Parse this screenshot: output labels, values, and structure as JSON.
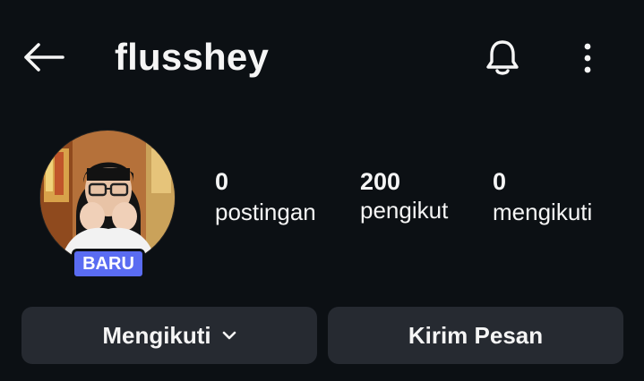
{
  "header": {
    "username": "flusshey",
    "back_icon": "arrow-left-icon",
    "notification_icon": "bell-icon",
    "more_icon": "vertical-dots-icon"
  },
  "profile": {
    "badge": "BARU",
    "stats": {
      "posts": {
        "count": "0",
        "label": "postingan"
      },
      "followers": {
        "count": "200",
        "label": "pengikut"
      },
      "following": {
        "count": "0",
        "label": "mengikuti"
      }
    }
  },
  "actions": {
    "follow_label": "Mengikuti",
    "message_label": "Kirim Pesan"
  },
  "colors": {
    "background": "#0c1014",
    "button": "#262a31",
    "badge": "#5a6cf2",
    "text": "#f5f5f5"
  }
}
